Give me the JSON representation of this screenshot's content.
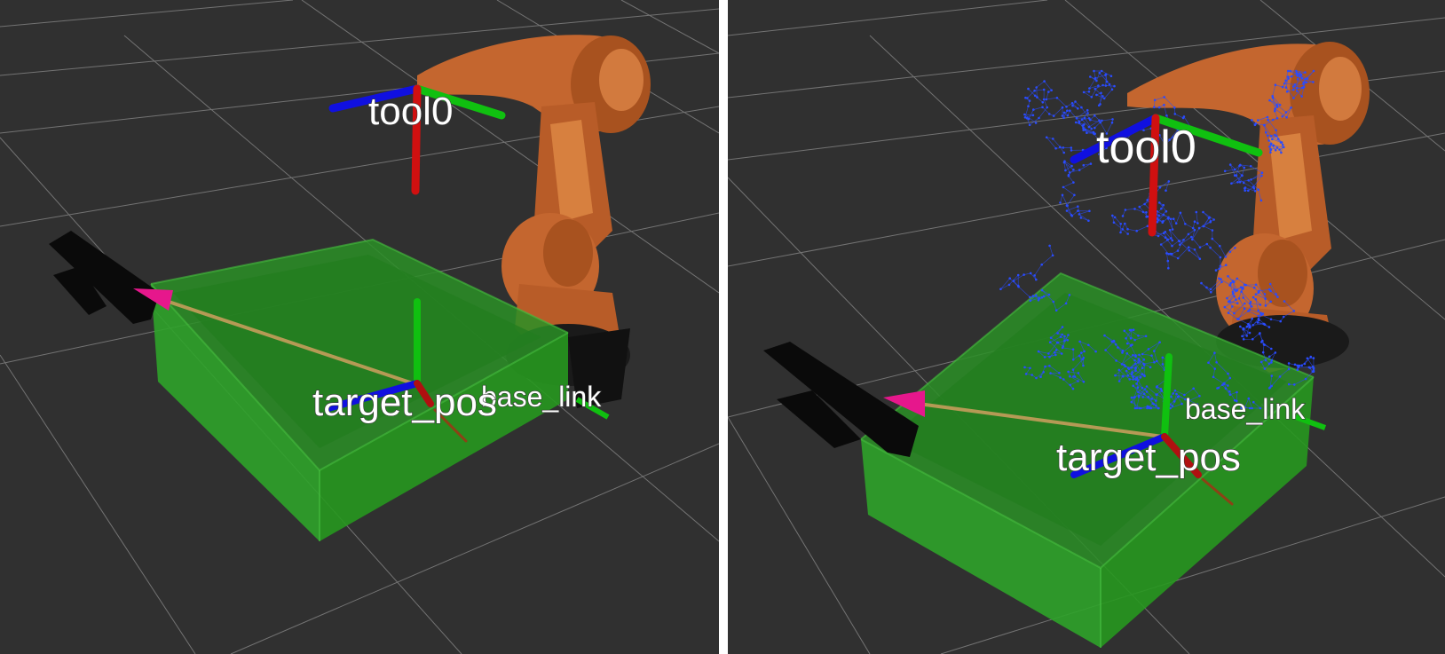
{
  "views": [
    {
      "labels": {
        "tool": "tool0",
        "target": "target_pos",
        "base": "base_link"
      },
      "show_path_cloud": false
    },
    {
      "labels": {
        "tool": "tool0",
        "target": "target_pos",
        "base": "base_link"
      },
      "show_path_cloud": true
    }
  ],
  "colors": {
    "background": "#303030",
    "grid": "#8a8a8a",
    "robot_orange": "#c4662f",
    "obstacle_box_green": "#2fa32a",
    "camera_black": "#0a0a0a",
    "arrow_magenta": "#e6178c",
    "ray_tan": "#b59a55",
    "axis_x_red": "#d01010",
    "axis_y_green": "#10c010",
    "axis_z_blue": "#1010e0",
    "path_points_blue": "#2a4cff"
  }
}
